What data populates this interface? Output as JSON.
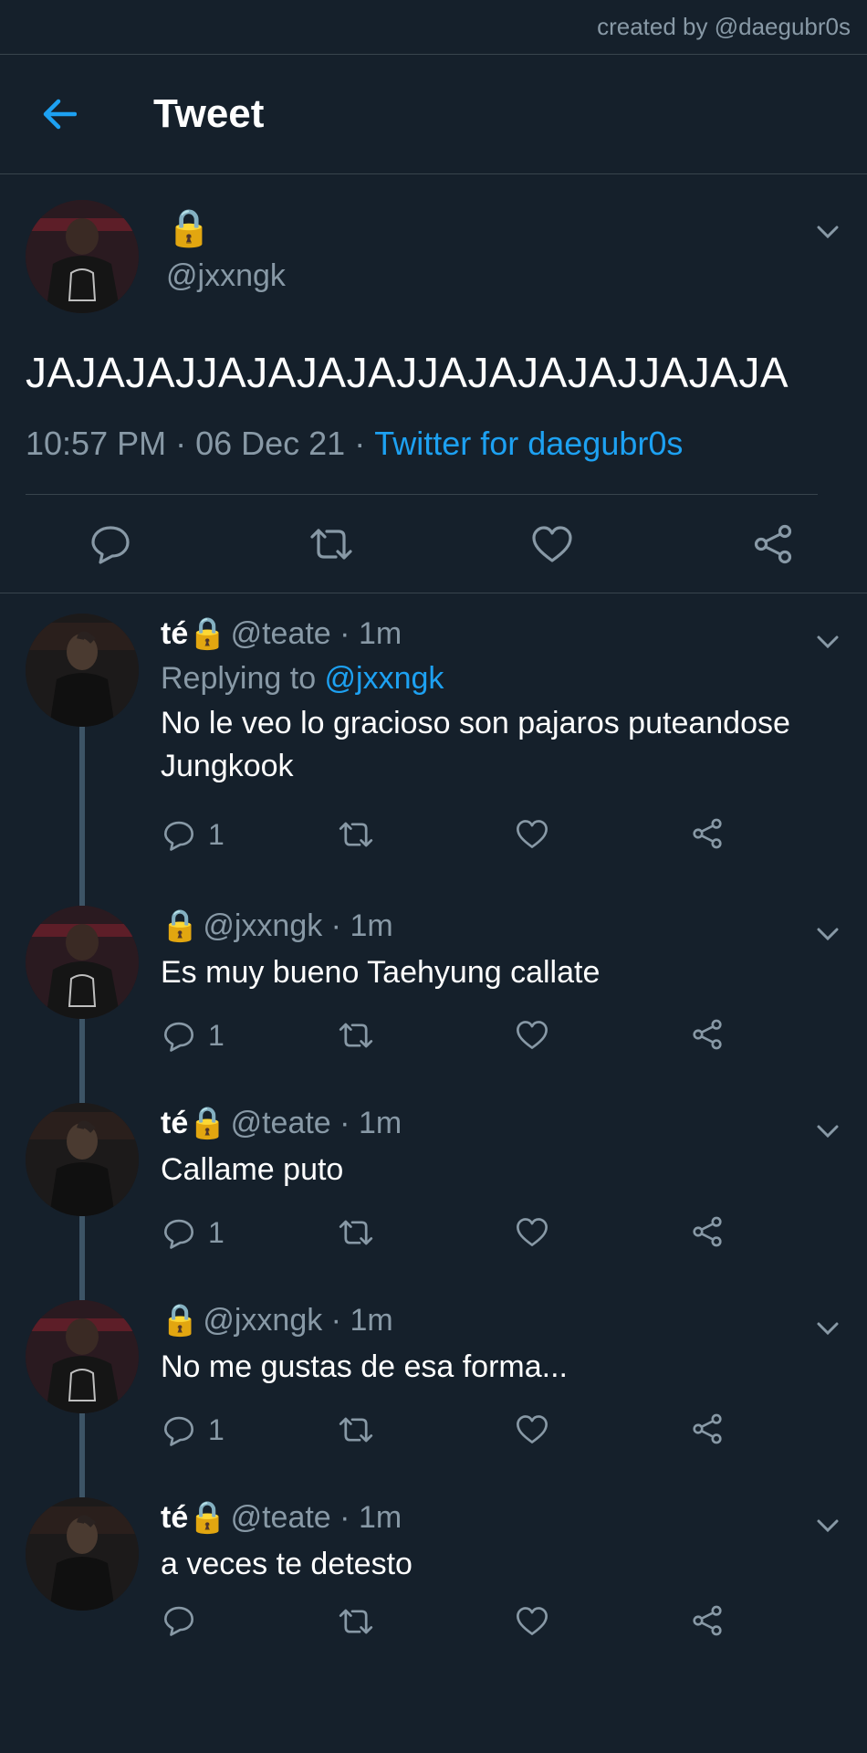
{
  "credit": "created by @daegubr0s",
  "header": {
    "title": "Tweet"
  },
  "main_tweet": {
    "lock": "🔒",
    "handle": "@jxxngk",
    "text": "JAJAJAJJAJAJAJAJJAJAJAJAJJAJAJA",
    "time": "10:57 PM",
    "sep1": " · ",
    "date": "06 Dec 21",
    "sep2": " · ",
    "source": "Twitter for daegubr0s"
  },
  "replies": [
    {
      "name": "té",
      "lock": "🔒",
      "handle": "@teate",
      "dot": " · ",
      "time": "1m",
      "replying_prefix": "Replying to ",
      "replying_to": "@jxxngk",
      "text": "No le veo lo gracioso son pajaros puteandose Jungkook",
      "reply_count": "1"
    },
    {
      "name": "",
      "lock": "🔒",
      "handle": "@jxxngk",
      "dot": " · ",
      "time": "1m",
      "text": "Es muy bueno Taehyung callate",
      "reply_count": "1"
    },
    {
      "name": "té",
      "lock": "🔒",
      "handle": "@teate",
      "dot": " · ",
      "time": "1m",
      "text": "Callame puto",
      "reply_count": "1"
    },
    {
      "name": "",
      "lock": "🔒",
      "handle": "@jxxngk",
      "dot": " · ",
      "time": "1m",
      "text": "No me gustas de esa forma...",
      "reply_count": "1"
    },
    {
      "name": "té",
      "lock": "🔒",
      "handle": "@teate",
      "dot": " · ",
      "time": "1m",
      "text": "a veces te detesto",
      "reply_count": ""
    }
  ],
  "icons": {
    "back": "back-arrow-icon",
    "caret": "chevron-down-icon",
    "reply": "reply-icon",
    "retweet": "retweet-icon",
    "like": "heart-icon",
    "share": "share-icon"
  },
  "colors": {
    "background": "#15202b",
    "accent": "#1da1f2",
    "muted": "#8899a6",
    "divider": "#38444d"
  }
}
